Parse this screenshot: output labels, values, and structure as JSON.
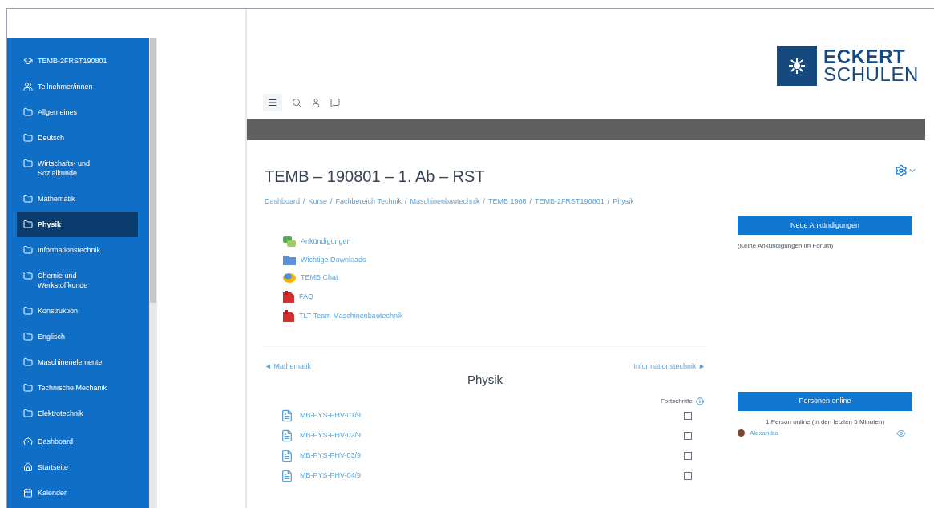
{
  "sidebar": {
    "items": [
      {
        "label": "TEMB-2FRST190801",
        "kind": "course",
        "selected": false
      },
      {
        "label": "Teilnehmer/innen",
        "kind": "users",
        "selected": false
      },
      {
        "label": "Allgemeines",
        "kind": "section",
        "selected": false
      },
      {
        "label": "Deutsch",
        "kind": "section",
        "selected": false
      },
      {
        "label": "Wirtschafts- und Sozialkunde",
        "kind": "section",
        "selected": false
      },
      {
        "label": "Mathematik",
        "kind": "section",
        "selected": false
      },
      {
        "label": "Physik",
        "kind": "section",
        "selected": true
      },
      {
        "label": "Informationstechnik",
        "kind": "section",
        "selected": false
      },
      {
        "label": "Chemie und Werkstoffkunde",
        "kind": "section",
        "selected": false
      },
      {
        "label": "Konstruktion",
        "kind": "section",
        "selected": false
      },
      {
        "label": "Englisch",
        "kind": "section",
        "selected": false
      },
      {
        "label": "Maschinenelemente",
        "kind": "section",
        "selected": false
      },
      {
        "label": "Technische Mechanik",
        "kind": "section",
        "selected": false
      },
      {
        "label": "Elektrotechnik",
        "kind": "section",
        "selected": false
      },
      {
        "label": "Dashboard",
        "kind": "dashboard",
        "selected": false
      },
      {
        "label": "Startseite",
        "kind": "home",
        "selected": false
      },
      {
        "label": "Kalender",
        "kind": "calendar",
        "selected": false
      }
    ]
  },
  "logo": {
    "line1": "ECKERT",
    "line2": "SCHULEN"
  },
  "page": {
    "title": "TEMB – 190801 – 1. Ab – RST",
    "breadcrumb": [
      {
        "label": "Dashboard"
      },
      {
        "separator": "/",
        "label": "Kurse"
      },
      {
        "separator": "/",
        "label": "Fachbereich Technik"
      },
      {
        "separator": "/",
        "label": "Maschinenbautechnik"
      },
      {
        "separator": "/",
        "label": "TEMB 1908"
      },
      {
        "separator": "/",
        "label": "TEMB-2FRST190801"
      },
      {
        "separator": "/",
        "label": "Physik"
      }
    ]
  },
  "activities": [
    {
      "label": "Ankündigungen",
      "kind": "forum"
    },
    {
      "label": "Wichtige Downloads",
      "kind": "folder"
    },
    {
      "label": "TEMB Chat",
      "kind": "chat"
    },
    {
      "label": "FAQ",
      "kind": "pdf"
    },
    {
      "label": "TLT-Team Maschinenbautechnik",
      "kind": "pdf"
    }
  ],
  "section_nav": {
    "previous": "◄ Mathematik",
    "next": "Informationstechnik ►",
    "title": "Physik"
  },
  "progress_label": "Fortschritte",
  "files": [
    {
      "label": "MB-PYS-PHV-01/9",
      "checked": false
    },
    {
      "label": "MB-PYS-PHV-02/9",
      "checked": false
    },
    {
      "label": "MB-PYS-PHV-03/9",
      "checked": false
    },
    {
      "label": "MB-PYS-PHV-04/9",
      "checked": false
    }
  ],
  "blocks": {
    "news": {
      "title": "Neue Ankündigungen",
      "text": "(Keine Ankündigungen im Forum)"
    },
    "online": {
      "title": "Personen online",
      "text": "1 Person online (in den letzten 5 Minuten)",
      "user": "Alexandra"
    }
  }
}
